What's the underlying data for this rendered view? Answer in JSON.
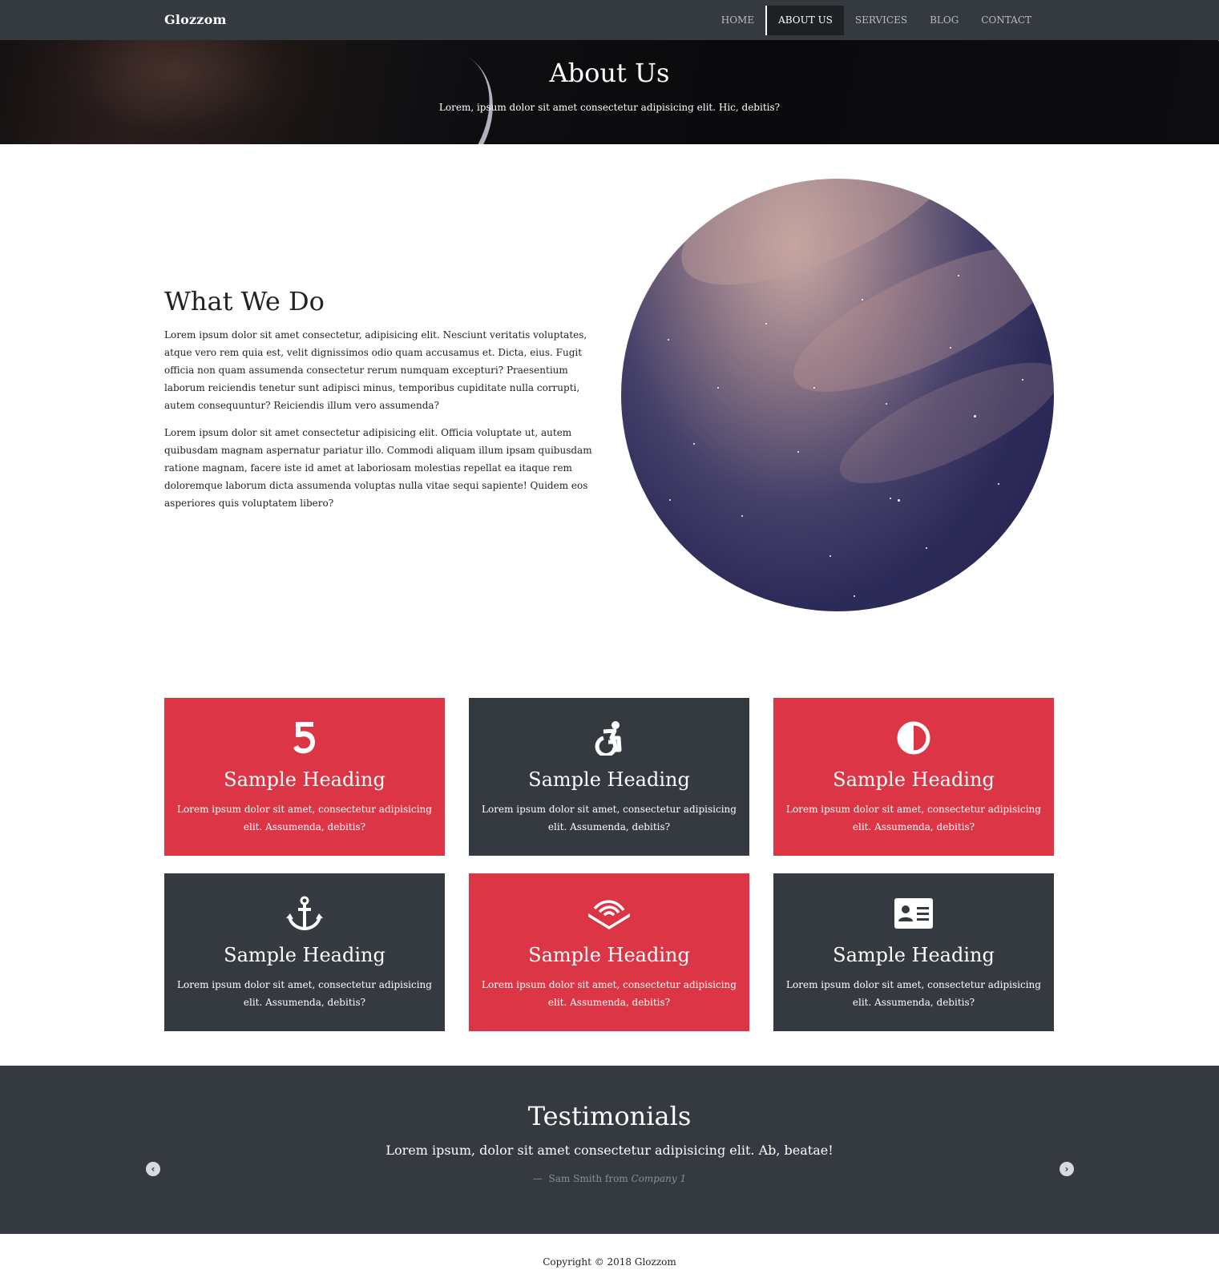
{
  "nav": {
    "brand": "Glozzom",
    "items": [
      {
        "label": "HOME"
      },
      {
        "label": "ABOUT US",
        "active": true
      },
      {
        "label": "SERVICES"
      },
      {
        "label": "BLOG"
      },
      {
        "label": "CONTACT"
      }
    ]
  },
  "hero": {
    "title": "About Us",
    "subtitle": "Lorem, ipsum dolor sit amet consectetur adipisicing elit. Hic, debitis?"
  },
  "about": {
    "heading": "What We Do",
    "paragraphs": [
      "Lorem ipsum dolor sit amet consectetur, adipisicing elit. Nesciunt veritatis voluptates, atque vero rem quia est, velit dignissimos odio quam accusamus et. Dicta, eius. Fugit officia non quam assumenda consectetur rerum numquam excepturi? Praesentium laborum reiciendis tenetur sunt adipisci minus, temporibus cupiditate nulla corrupti, autem consequuntur? Reiciendis illum vero assumenda?",
      "Lorem ipsum dolor sit amet consectetur adipisicing elit. Officia voluptate ut, autem quibusdam magnam aspernatur pariatur illo. Commodi aliquam illum ipsam quibusdam ratione magnam, facere iste id amet at laboriosam molestias repellat ea itaque rem doloremque laborum dicta assumenda voluptas nulla vitae sequi sapiente! Quidem eos asperiores quis voluptatem libero?"
    ]
  },
  "cards": [
    {
      "icon": "html5-icon",
      "color": "red",
      "heading": "Sample Heading",
      "text": "Lorem ipsum dolor sit amet, consectetur adipisicing elit. Assumenda, debitis?"
    },
    {
      "icon": "accessibility-icon",
      "color": "dark",
      "heading": "Sample Heading",
      "text": "Lorem ipsum dolor sit amet, consectetur adipisicing elit. Assumenda, debitis?"
    },
    {
      "icon": "adjust-icon",
      "color": "red",
      "heading": "Sample Heading",
      "text": "Lorem ipsum dolor sit amet, consectetur adipisicing elit. Assumenda, debitis?"
    },
    {
      "icon": "anchor-icon",
      "color": "dark",
      "heading": "Sample Heading",
      "text": "Lorem ipsum dolor sit amet, consectetur adipisicing elit. Assumenda, debitis?"
    },
    {
      "icon": "audible-icon",
      "color": "red",
      "heading": "Sample Heading",
      "text": "Lorem ipsum dolor sit amet, consectetur adipisicing elit. Assumenda, debitis?"
    },
    {
      "icon": "id-card-icon",
      "color": "dark",
      "heading": "Sample Heading",
      "text": "Lorem ipsum dolor sit amet, consectetur adipisicing elit. Assumenda, debitis?"
    }
  ],
  "testimonials": {
    "heading": "Testimonials",
    "quote": "Lorem ipsum, dolor sit amet consectetur adipisicing elit. Ab, beatae!",
    "dash": "—",
    "author": "Sam Smith from",
    "company": "Company 1",
    "prev_icon": "‹",
    "next_icon": "›"
  },
  "footer": {
    "copyright": "Copyright © 2018 Glozzom"
  },
  "colors": {
    "dark": "#343a40",
    "red": "#dc3545"
  }
}
